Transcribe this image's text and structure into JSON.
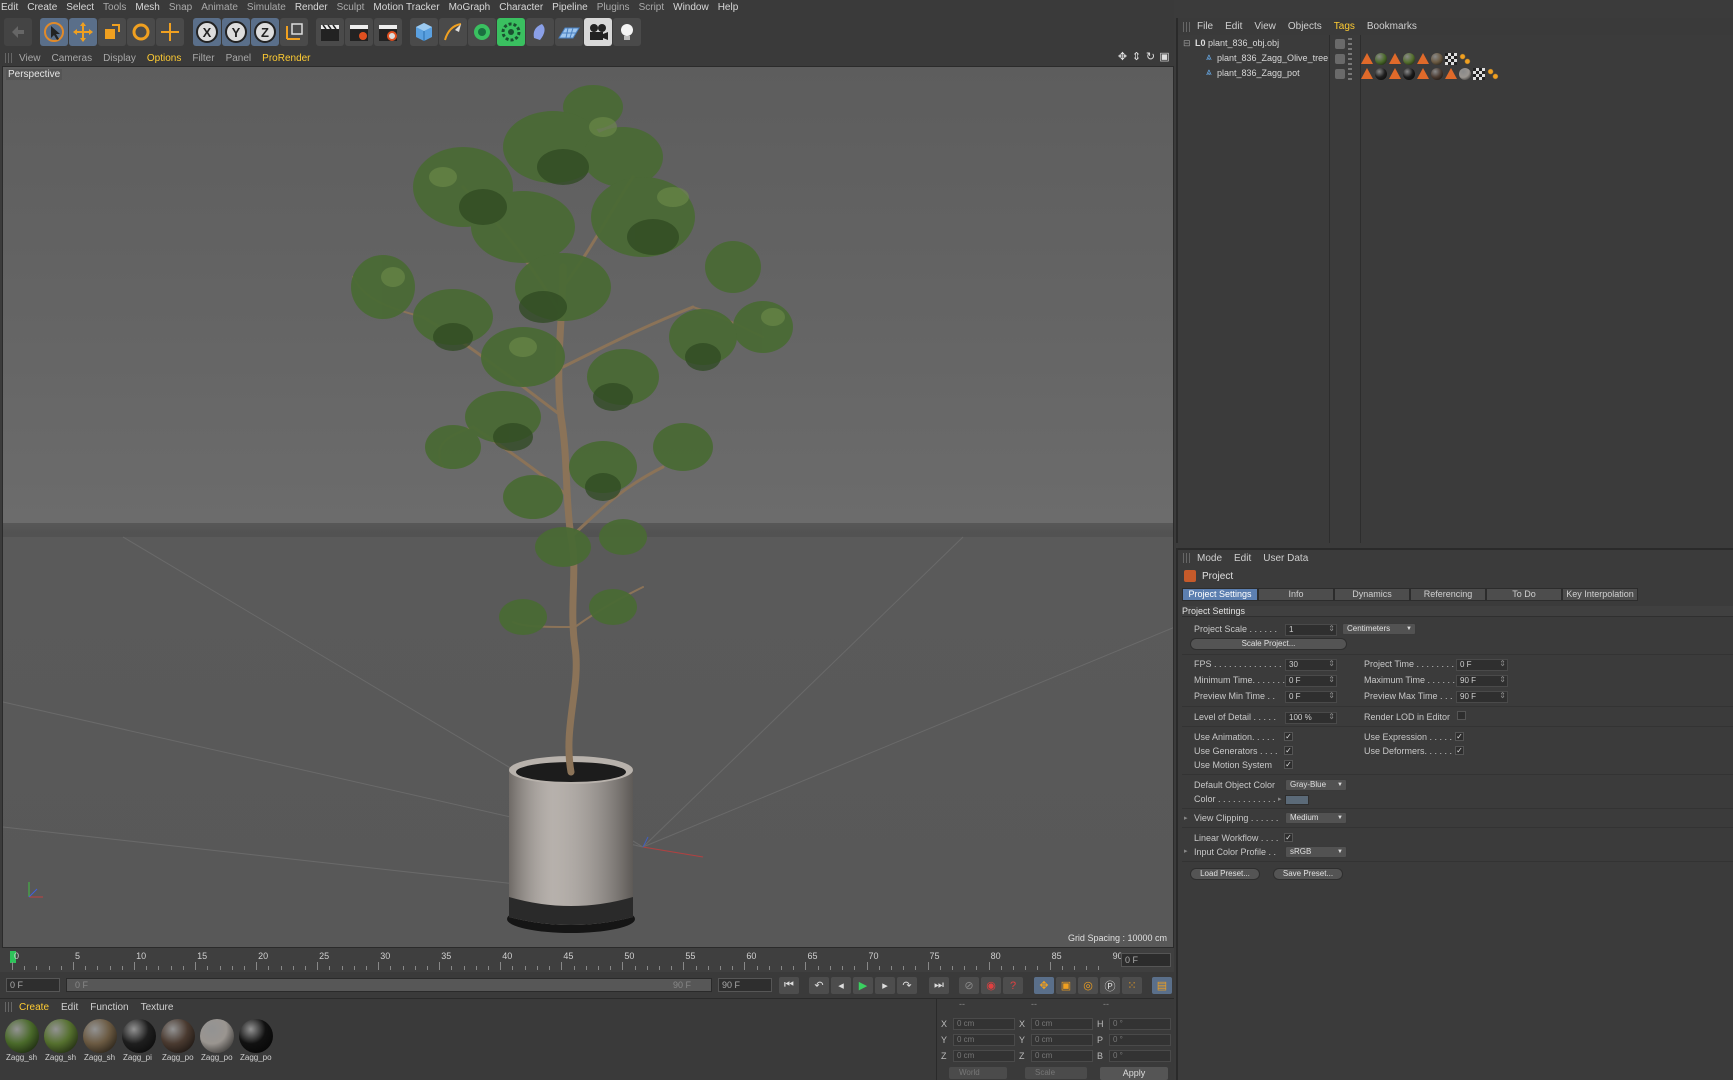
{
  "menu": [
    "Edit",
    "Create",
    "Select",
    "Tools",
    "Mesh",
    "Snap",
    "Animate",
    "Simulate",
    "Render",
    "Sculpt",
    "Motion Tracker",
    "MoGraph",
    "Character",
    "Pipeline",
    "Plugins",
    "Script",
    "Window",
    "Help"
  ],
  "viewport": {
    "menu": [
      "View",
      "Cameras",
      "Display",
      "Options",
      "Filter",
      "Panel",
      "ProRender"
    ],
    "label": "Perspective",
    "grid_spacing": "Grid Spacing : 10000 cm"
  },
  "timeline": {
    "ticks": [
      "0",
      "5",
      "10",
      "15",
      "20",
      "25",
      "30",
      "35",
      "40",
      "45",
      "50",
      "55",
      "60",
      "65",
      "70",
      "75",
      "80",
      "85",
      "90"
    ],
    "current_frame": "0 F",
    "start_field": "0 F",
    "range_start": "0 F",
    "range_end": "90 F",
    "end_field": "90 F"
  },
  "materials": {
    "menu": [
      "Create",
      "Edit",
      "Function",
      "Texture"
    ],
    "items": [
      {
        "name": "Zagg_sh",
        "color": "#4a6a2a"
      },
      {
        "name": "Zagg_sh",
        "color": "#55702e"
      },
      {
        "name": "Zagg_sh",
        "color": "#6b5a42"
      },
      {
        "name": "Zagg_pi",
        "color": "#1e1e1e"
      },
      {
        "name": "Zagg_po",
        "color": "#4a3a30"
      },
      {
        "name": "Zagg_po",
        "color": "#9a9590"
      },
      {
        "name": "Zagg_po",
        "color": "#111111"
      }
    ]
  },
  "coords": {
    "headers": [
      "--",
      "--",
      "--"
    ],
    "rows": [
      {
        "a1": "X",
        "v1": "0 cm",
        "a2": "X",
        "v2": "0 cm",
        "a3": "H",
        "v3": "0 °"
      },
      {
        "a1": "Y",
        "v1": "0 cm",
        "a2": "Y",
        "v2": "0 cm",
        "a3": "P",
        "v3": "0 °"
      },
      {
        "a1": "Z",
        "v1": "0 cm",
        "a2": "Z",
        "v2": "0 cm",
        "a3": "B",
        "v3": "0 °"
      }
    ],
    "world": "World",
    "scale": "Scale",
    "apply": "Apply"
  },
  "objects": {
    "menu": [
      "File",
      "Edit",
      "View",
      "Objects",
      "Tags",
      "Bookmarks"
    ],
    "items": [
      {
        "name": "plant_836_obj.obj"
      },
      {
        "name": "plant_836_Zagg_Olive_tree"
      },
      {
        "name": "plant_836_Zagg_pot"
      }
    ]
  },
  "attributes": {
    "menu": [
      "Mode",
      "Edit",
      "User Data"
    ],
    "title": "Project",
    "tabs": [
      "Project Settings",
      "Info",
      "Dynamics",
      "Referencing",
      "To Do",
      "Key Interpolation"
    ],
    "section": "Project Settings",
    "project_scale_label": "Project Scale . . . . . .",
    "project_scale_value": "1",
    "project_scale_unit": "Centimeters",
    "scale_project_btn": "Scale Project...",
    "fps_label": "FPS . . . . . . . . . . . . . .",
    "fps_value": "30",
    "project_time_label": "Project Time . . . . . . . .",
    "project_time_value": "0 F",
    "min_time_label": "Minimum Time. . . . . . .",
    "min_time_value": "0 F",
    "max_time_label": "Maximum Time . . . . . .",
    "max_time_value": "90 F",
    "prev_min_label": "Preview Min Time . .",
    "prev_min_value": "0 F",
    "prev_max_label": "Preview Max Time . . .",
    "prev_max_value": "90 F",
    "lod_label": "Level of Detail . . . . .",
    "lod_value": "100 %",
    "render_lod_label": "Render LOD in Editor",
    "use_anim_label": "Use Animation. . . . .",
    "use_expr_label": "Use Expression . . . . .",
    "use_gen_label": "Use Generators . . . .",
    "use_def_label": "Use Deformers. . . . . .",
    "use_motion_label": "Use Motion System",
    "def_color_label": "Default Object Color",
    "def_color_value": "Gray-Blue",
    "color_label": "Color . . . . . . . . . . . .",
    "view_clip_label": "View Clipping . . . . . .",
    "view_clip_value": "Medium",
    "linear_label": "Linear Workflow . . . .",
    "icp_label": "Input Color Profile . .",
    "icp_value": "sRGB",
    "load_preset": "Load Preset...",
    "save_preset": "Save Preset..."
  }
}
